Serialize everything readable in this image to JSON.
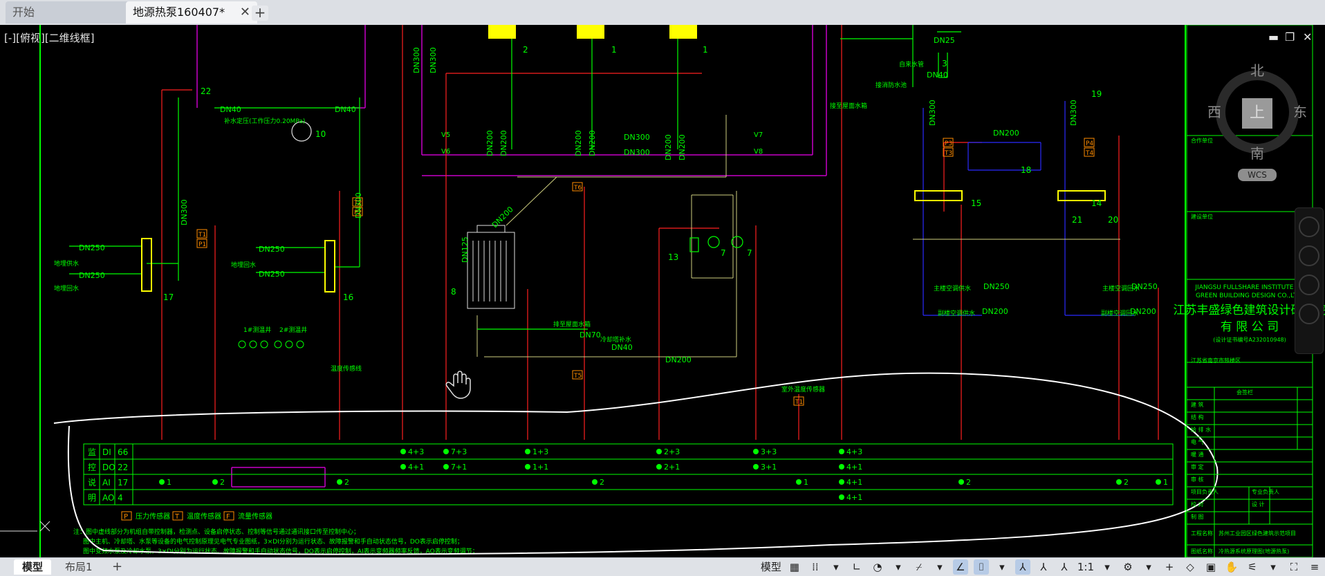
{
  "tabs": {
    "start": "开始",
    "file": "地源热泵160407*",
    "close": "✕",
    "add": "+"
  },
  "viewport": {
    "label": "[-][俯视][二维线框]"
  },
  "viewcube": {
    "north": "北",
    "south": "南",
    "east": "东",
    "west": "西",
    "top": "上",
    "wcs": "WCS"
  },
  "window_controls": {
    "minimize": "▬",
    "restore": "❐",
    "close": "✕"
  },
  "drawing": {
    "dn": [
      "DN40",
      "DN40",
      "DN300",
      "DN250",
      "DN250",
      "DN250",
      "DN250",
      "DN300",
      "DN300",
      "DN300",
      "DN200",
      "DN200",
      "DN200",
      "DN200",
      "DN200",
      "DN200",
      "DN300",
      "DN300",
      "DN200",
      "DN125",
      "DN70",
      "DN40",
      "DN200",
      "DN25",
      "DN40",
      "DN200",
      "DN300",
      "DN300",
      "DN250",
      "DN200",
      "DN250",
      "DN200"
    ],
    "labels": [
      "地埋供水",
      "地埋回水",
      "地埋回水",
      "1#测温井",
      "2#测温井",
      "温度传感线",
      "室外温度传感器",
      "冷却塔补水",
      "接至屋面水箱",
      "接消防水池",
      "主楼空调供水",
      "副楼空调供水",
      "主楼空调回水",
      "副楼空调回水",
      "补水定压(工作压力0.20MPa)",
      "排至屋面水箱",
      "自来水管"
    ],
    "numbers": [
      "22",
      "10",
      "17",
      "16",
      "2",
      "1",
      "1",
      "8",
      "13",
      "7",
      "7",
      "15",
      "14",
      "18",
      "19",
      "21",
      "20",
      "3"
    ],
    "codes": [
      "V5",
      "V6",
      "V7",
      "V8",
      "T6",
      "T5",
      "T1",
      "P1",
      "T2",
      "P2",
      "P3",
      "T3",
      "P4",
      "T4",
      "T1"
    ]
  },
  "io_table": {
    "side_label": [
      "监",
      "控",
      "说",
      "明"
    ],
    "rows": [
      {
        "type": "DI",
        "count": "66"
      },
      {
        "type": "DO",
        "count": "22"
      },
      {
        "type": "AI",
        "count": "17"
      },
      {
        "type": "AO",
        "count": "4"
      }
    ],
    "cells": {
      "di": [
        "4+3",
        "7+3",
        "1+3",
        "2+3",
        "3+3",
        "4+3"
      ],
      "do": [
        "4+1",
        "7+1",
        "1+1",
        "2+1",
        "3+1",
        "4+1"
      ],
      "ai": [
        "1",
        "2",
        "2",
        "2",
        "1",
        "4+1",
        "2",
        "2",
        "1"
      ],
      "ao": [
        "4+1"
      ]
    },
    "legend": [
      {
        "box": "P",
        "text": "压力传感器"
      },
      {
        "box": "T",
        "text": "温度传感器"
      },
      {
        "box": "F",
        "text": "流量传感器"
      }
    ],
    "notes": [
      "注：图中虚线部分为机组自带控制器，检测点、设备启停状态、控制等信号通过通讯接口传至控制中心；",
      "图中主机、冷却塔、水泵等设备的电气控制原理见电气专业图纸，3×DI分别为运行状态、故障报警和手自动状态信号，DO表示启停控制；",
      "图中变频水泵及冷却水泵，3×DI分别为运行状态、故障报警和手自动状态信号，DO表示启停控制，AI表示变频器频率反馈，AO表示变频调节；"
    ]
  },
  "title_block": {
    "en1": "JIANGSU FULLSHARE INSTITUTE OF",
    "en2": "GREEN BUILDING DESIGN CO.,LTD.",
    "cn1": "江苏丰盛绿色建筑设计研究院",
    "cn2": "有 限 公 司",
    "cert": "(设计证书编号A232010948)",
    "address": "江苏省南京市鼓楼区",
    "fields": [
      "会签栏",
      "建 筑",
      "结 构",
      "给 排 水",
      "电 气",
      "暖 通",
      "审 定",
      "审 核",
      "项目负责人",
      "专业负责人",
      "校 对",
      "设 计",
      "制 图"
    ],
    "project_label": "工程名称",
    "drawing_label": "图纸名称",
    "project": "苏州工业园区绿色建筑示范项目",
    "drawing": "冷热源系统原理图(地源热泵)",
    "header_left": "合作单位",
    "header_right": "建设单位"
  },
  "statusbar": {
    "model_tab": "模型",
    "layout_tab": "布局1",
    "add": "+",
    "mode": "模型",
    "scale": "1:1"
  }
}
